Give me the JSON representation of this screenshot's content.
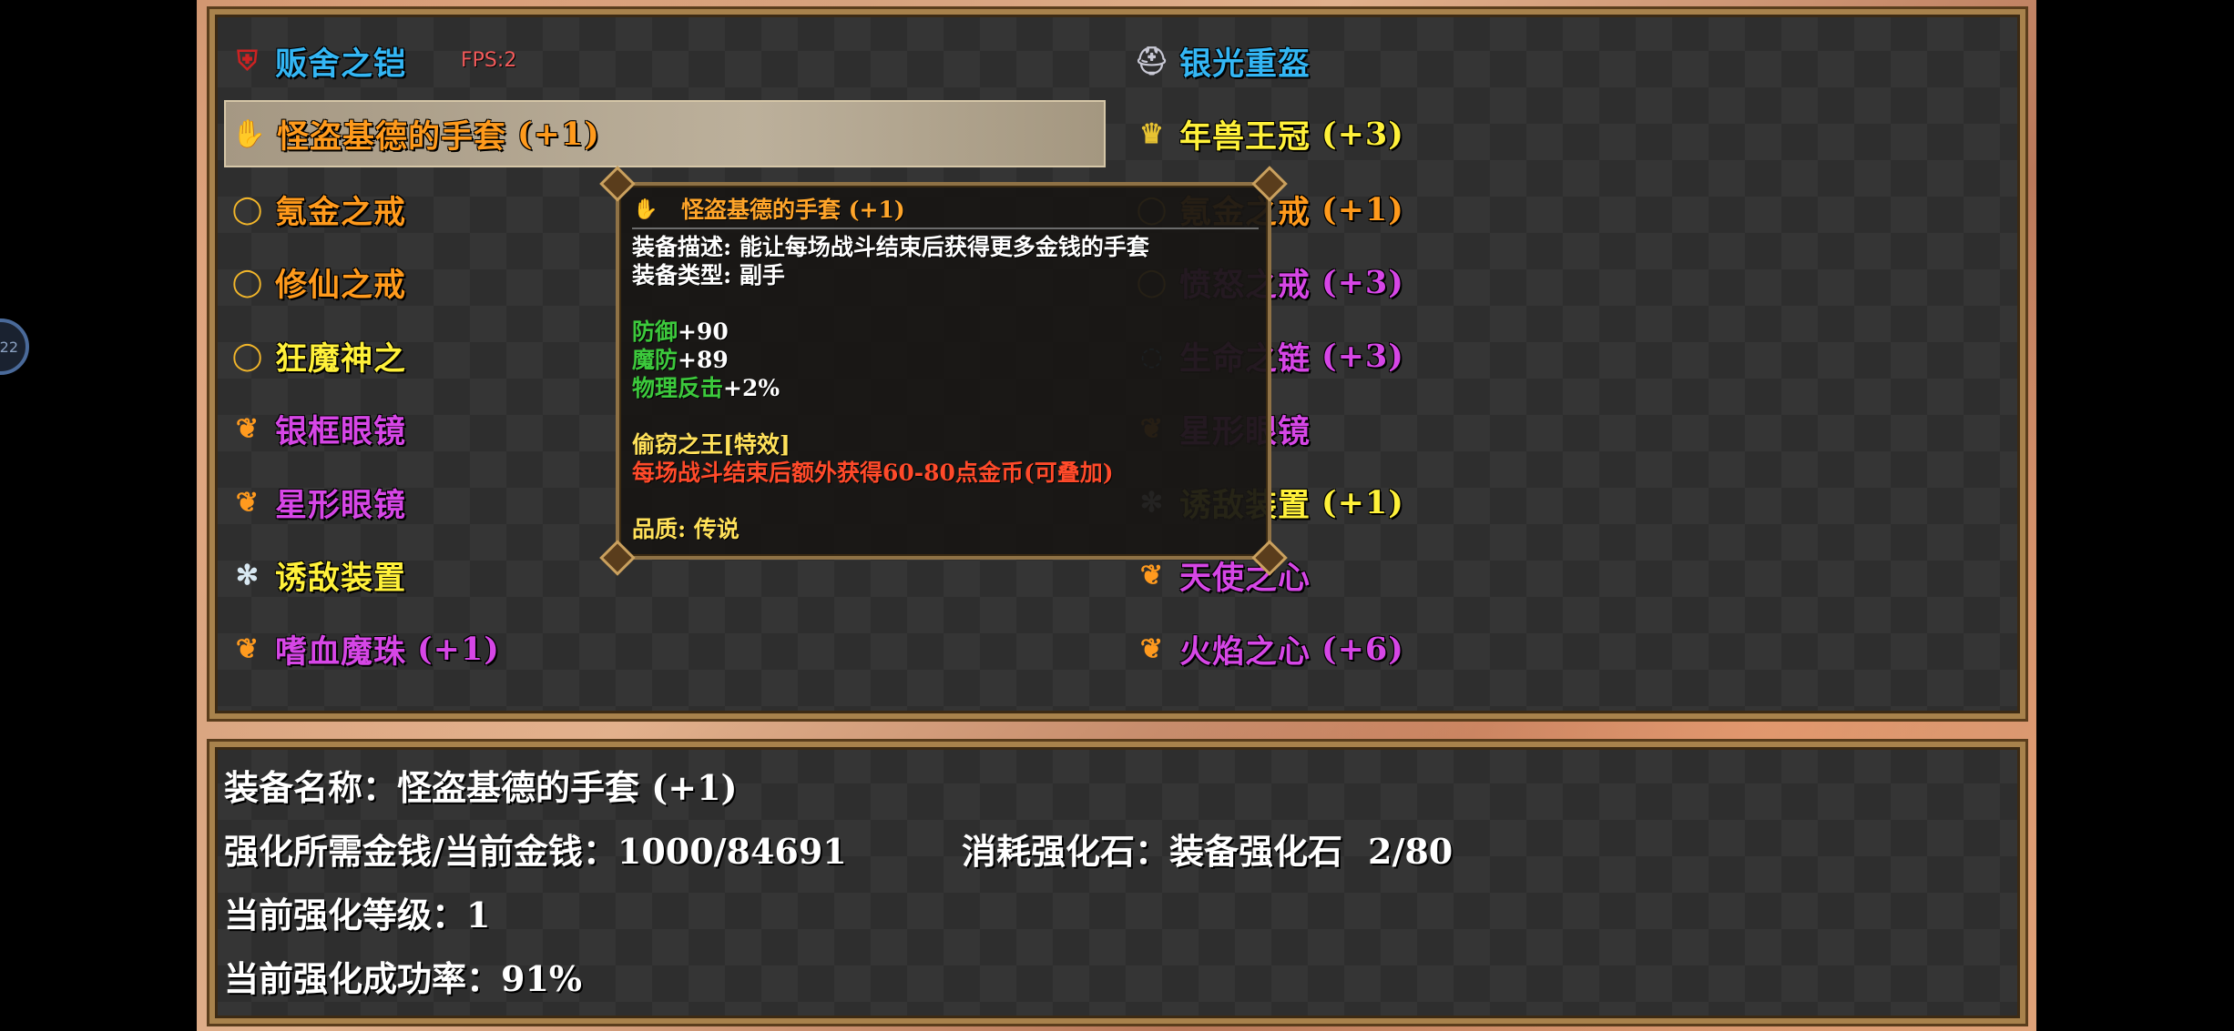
{
  "fps_label": "FPS:",
  "fps_value": "2",
  "side_circle": "22",
  "left_items": [
    {
      "name": "贩舍之铠",
      "level": "",
      "color": "blue",
      "icon": "armor-icon"
    },
    {
      "name": "怪盗基德的手套",
      "level": "(+1)",
      "color": "orange",
      "icon": "glove-icon",
      "selected": true
    },
    {
      "name": "氪金之戒",
      "level": "",
      "color": "orange",
      "icon": "ring-icon"
    },
    {
      "name": "修仙之戒",
      "level": "",
      "color": "orange",
      "icon": "ring-icon"
    },
    {
      "name": "狂魔神之",
      "level": "",
      "color": "yellow",
      "icon": "ring-icon"
    },
    {
      "name": "银框眼镜",
      "level": "",
      "color": "purple",
      "icon": "flame-gem-icon"
    },
    {
      "name": "星形眼镜",
      "level": "",
      "color": "purple",
      "icon": "flame-gem-icon"
    },
    {
      "name": "诱敌装置",
      "level": "",
      "color": "yellow",
      "icon": "snowflake-icon"
    },
    {
      "name": "嗜血魔珠",
      "level": "(+1)",
      "color": "purple",
      "icon": "flame-gem-icon"
    }
  ],
  "right_items": [
    {
      "name": "银光重盔",
      "level": "",
      "color": "blue",
      "icon": "helmet-icon"
    },
    {
      "name": "年兽王冠",
      "level": "(+3)",
      "color": "yellow",
      "icon": "crown-icon"
    },
    {
      "name": "氪金之戒",
      "level": "(+1)",
      "color": "orange",
      "icon": "ring-icon"
    },
    {
      "name": "愤怒之戒",
      "level": "(+3)",
      "color": "purple",
      "icon": "ring-icon"
    },
    {
      "name": "生命之链",
      "level": "(+3)",
      "color": "purple",
      "icon": "chain-icon"
    },
    {
      "name": "星形眼镜",
      "level": "",
      "color": "purple",
      "icon": "flame-gem-icon"
    },
    {
      "name": "诱敌装置",
      "level": "(+1)",
      "color": "yellow",
      "icon": "snowflake-icon"
    },
    {
      "name": "天使之心",
      "level": "",
      "color": "purple",
      "icon": "flame-gem-icon"
    },
    {
      "name": "火焰之心",
      "level": "(+6)",
      "color": "purple",
      "icon": "flame-gem-icon"
    }
  ],
  "tooltip": {
    "title": "怪盗基德的手套 (+1)",
    "desc": "装备描述: 能让每场战斗结束后获得更多金钱的手套",
    "type": "装备类型: 副手",
    "stats": [
      {
        "label": "防御",
        "value": "+90"
      },
      {
        "label": "魔防",
        "value": "+89"
      },
      {
        "label": "物理反击",
        "value": "+2%"
      }
    ],
    "special_name": "偷窃之王[特效]",
    "special_desc": "每场战斗结束后额外获得60-80点金币(可叠加)",
    "quality": "品质: 传说"
  },
  "info": {
    "name_label": "装备名称：",
    "name_value": "怪盗基德的手套 (+1)",
    "cost_label": "强化所需金钱/当前金钱：",
    "cost_value": "1000/84691",
    "stone_label": "消耗强化石：",
    "stone_name": "装备强化石",
    "stone_value": "2/80",
    "level_label": "当前强化等级：",
    "level_value": "1",
    "rate_label": "当前强化成功率：",
    "rate_value": "91%"
  },
  "colors": {
    "blue": "#33b6f4",
    "orange": "#ff9a1c",
    "yellow": "#fff13a",
    "purple": "#d646e6",
    "frame": "#a8824c"
  }
}
